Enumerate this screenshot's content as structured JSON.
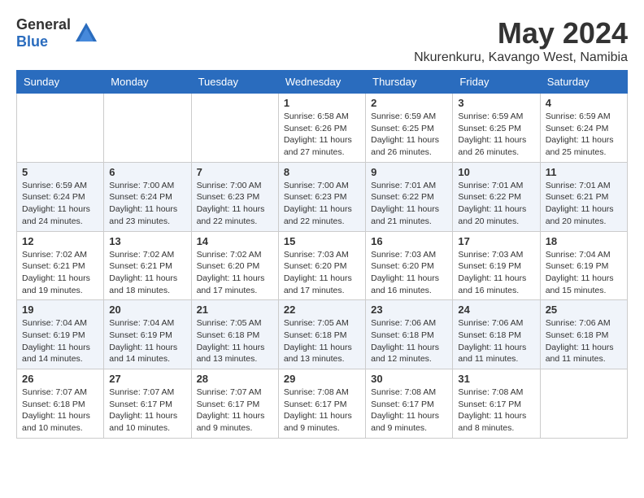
{
  "header": {
    "logo_general": "General",
    "logo_blue": "Blue",
    "month": "May 2024",
    "location": "Nkurenkuru, Kavango West, Namibia"
  },
  "weekdays": [
    "Sunday",
    "Monday",
    "Tuesday",
    "Wednesday",
    "Thursday",
    "Friday",
    "Saturday"
  ],
  "weeks": [
    [
      {
        "day": "",
        "info": ""
      },
      {
        "day": "",
        "info": ""
      },
      {
        "day": "",
        "info": ""
      },
      {
        "day": "1",
        "info": "Sunrise: 6:58 AM\nSunset: 6:26 PM\nDaylight: 11 hours and 27 minutes."
      },
      {
        "day": "2",
        "info": "Sunrise: 6:59 AM\nSunset: 6:25 PM\nDaylight: 11 hours and 26 minutes."
      },
      {
        "day": "3",
        "info": "Sunrise: 6:59 AM\nSunset: 6:25 PM\nDaylight: 11 hours and 26 minutes."
      },
      {
        "day": "4",
        "info": "Sunrise: 6:59 AM\nSunset: 6:24 PM\nDaylight: 11 hours and 25 minutes."
      }
    ],
    [
      {
        "day": "5",
        "info": "Sunrise: 6:59 AM\nSunset: 6:24 PM\nDaylight: 11 hours and 24 minutes."
      },
      {
        "day": "6",
        "info": "Sunrise: 7:00 AM\nSunset: 6:24 PM\nDaylight: 11 hours and 23 minutes."
      },
      {
        "day": "7",
        "info": "Sunrise: 7:00 AM\nSunset: 6:23 PM\nDaylight: 11 hours and 22 minutes."
      },
      {
        "day": "8",
        "info": "Sunrise: 7:00 AM\nSunset: 6:23 PM\nDaylight: 11 hours and 22 minutes."
      },
      {
        "day": "9",
        "info": "Sunrise: 7:01 AM\nSunset: 6:22 PM\nDaylight: 11 hours and 21 minutes."
      },
      {
        "day": "10",
        "info": "Sunrise: 7:01 AM\nSunset: 6:22 PM\nDaylight: 11 hours and 20 minutes."
      },
      {
        "day": "11",
        "info": "Sunrise: 7:01 AM\nSunset: 6:21 PM\nDaylight: 11 hours and 20 minutes."
      }
    ],
    [
      {
        "day": "12",
        "info": "Sunrise: 7:02 AM\nSunset: 6:21 PM\nDaylight: 11 hours and 19 minutes."
      },
      {
        "day": "13",
        "info": "Sunrise: 7:02 AM\nSunset: 6:21 PM\nDaylight: 11 hours and 18 minutes."
      },
      {
        "day": "14",
        "info": "Sunrise: 7:02 AM\nSunset: 6:20 PM\nDaylight: 11 hours and 17 minutes."
      },
      {
        "day": "15",
        "info": "Sunrise: 7:03 AM\nSunset: 6:20 PM\nDaylight: 11 hours and 17 minutes."
      },
      {
        "day": "16",
        "info": "Sunrise: 7:03 AM\nSunset: 6:20 PM\nDaylight: 11 hours and 16 minutes."
      },
      {
        "day": "17",
        "info": "Sunrise: 7:03 AM\nSunset: 6:19 PM\nDaylight: 11 hours and 16 minutes."
      },
      {
        "day": "18",
        "info": "Sunrise: 7:04 AM\nSunset: 6:19 PM\nDaylight: 11 hours and 15 minutes."
      }
    ],
    [
      {
        "day": "19",
        "info": "Sunrise: 7:04 AM\nSunset: 6:19 PM\nDaylight: 11 hours and 14 minutes."
      },
      {
        "day": "20",
        "info": "Sunrise: 7:04 AM\nSunset: 6:19 PM\nDaylight: 11 hours and 14 minutes."
      },
      {
        "day": "21",
        "info": "Sunrise: 7:05 AM\nSunset: 6:18 PM\nDaylight: 11 hours and 13 minutes."
      },
      {
        "day": "22",
        "info": "Sunrise: 7:05 AM\nSunset: 6:18 PM\nDaylight: 11 hours and 13 minutes."
      },
      {
        "day": "23",
        "info": "Sunrise: 7:06 AM\nSunset: 6:18 PM\nDaylight: 11 hours and 12 minutes."
      },
      {
        "day": "24",
        "info": "Sunrise: 7:06 AM\nSunset: 6:18 PM\nDaylight: 11 hours and 11 minutes."
      },
      {
        "day": "25",
        "info": "Sunrise: 7:06 AM\nSunset: 6:18 PM\nDaylight: 11 hours and 11 minutes."
      }
    ],
    [
      {
        "day": "26",
        "info": "Sunrise: 7:07 AM\nSunset: 6:18 PM\nDaylight: 11 hours and 10 minutes."
      },
      {
        "day": "27",
        "info": "Sunrise: 7:07 AM\nSunset: 6:17 PM\nDaylight: 11 hours and 10 minutes."
      },
      {
        "day": "28",
        "info": "Sunrise: 7:07 AM\nSunset: 6:17 PM\nDaylight: 11 hours and 9 minutes."
      },
      {
        "day": "29",
        "info": "Sunrise: 7:08 AM\nSunset: 6:17 PM\nDaylight: 11 hours and 9 minutes."
      },
      {
        "day": "30",
        "info": "Sunrise: 7:08 AM\nSunset: 6:17 PM\nDaylight: 11 hours and 9 minutes."
      },
      {
        "day": "31",
        "info": "Sunrise: 7:08 AM\nSunset: 6:17 PM\nDaylight: 11 hours and 8 minutes."
      },
      {
        "day": "",
        "info": ""
      }
    ]
  ]
}
